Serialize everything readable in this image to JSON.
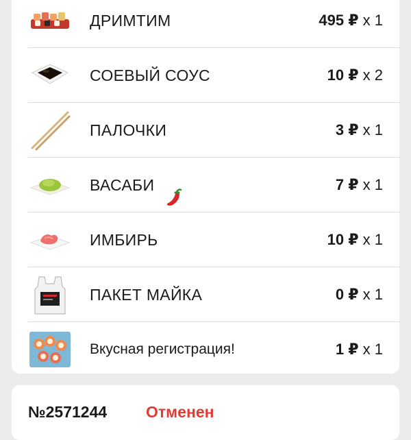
{
  "order_items": [
    {
      "name": "ДРИМТИМ",
      "price": "495 ₽",
      "qty": "x 1",
      "icon": "sushi-set-icon"
    },
    {
      "name": "СОЕВЫЙ СОУС",
      "price": "10 ₽",
      "qty": "x 2",
      "icon": "soy-sauce-icon"
    },
    {
      "name": "ПАЛОЧКИ",
      "price": "3 ₽",
      "qty": "x 1",
      "icon": "chopsticks-icon"
    },
    {
      "name": "ВАСАБИ",
      "price": "7 ₽",
      "qty": "x 1",
      "icon": "wasabi-icon"
    },
    {
      "name": "ИМБИРЬ",
      "price": "10 ₽",
      "qty": "x 1",
      "icon": "ginger-icon"
    },
    {
      "name": "ПАКЕТ МАЙКА",
      "price": "0 ₽",
      "qty": "x 1",
      "icon": "bag-icon"
    },
    {
      "name": "Вкусная регистрация!",
      "price": "1 ₽",
      "qty": "x 1",
      "icon": "sushi-rolls-icon"
    }
  ],
  "next_order": {
    "number": "№2571244",
    "status": "Отменен",
    "status_color": "#e23b34"
  },
  "colors": {
    "background": "#ececec",
    "card": "#ffffff",
    "divider": "#dcdcdc",
    "text": "#1a1a1a"
  }
}
